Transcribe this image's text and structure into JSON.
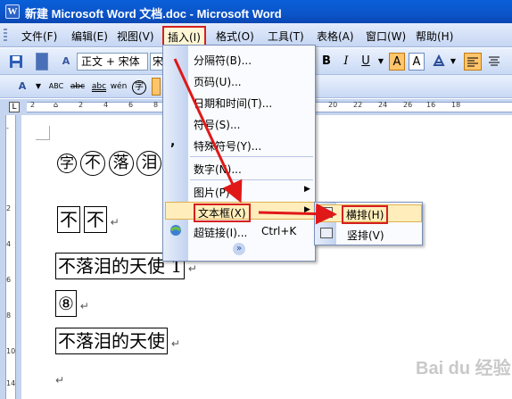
{
  "window": {
    "title": "新建 Microsoft Word 文档.doc - Microsoft Word",
    "app_icon": "W"
  },
  "menu": {
    "items": [
      "文件(F)",
      "编辑(E)",
      "视图(V)",
      "插入(I)",
      "格式(O)",
      "工具(T)",
      "表格(A)",
      "窗口(W)",
      "帮助(H)"
    ]
  },
  "toolbar": {
    "style_value": "正文 + 宋体",
    "font_value": "宋",
    "bold": "B",
    "italic": "I",
    "underline": "U",
    "char_shading": "A",
    "char_border": "A",
    "font_size_icon": "A",
    "abc1": "ABC",
    "abc2": "abc",
    "abc3": "abc",
    "pinyin": "wén",
    "enclose": "字"
  },
  "ruler": {
    "ticks": [
      "2",
      "2",
      "4",
      "6",
      "8",
      "10",
      "12",
      "14",
      "16",
      "18",
      "20",
      "22",
      "24",
      "26"
    ],
    "vticks": [
      "2",
      "4",
      "6",
      "8",
      "10",
      "12",
      "14"
    ]
  },
  "document": {
    "circ_chars": [
      "字",
      "不",
      "落",
      "泪"
    ],
    "boxed_line": [
      "不",
      "不"
    ],
    "line3": "不落泪的天使 1",
    "line4": "⑧",
    "line5": "不落泪的天使",
    "para_mark": "↵"
  },
  "insert_menu": {
    "items": [
      "分隔符(B)...",
      "页码(U)...",
      "日期和时间(T)...",
      "符号(S)...",
      "特殊符号(Y)...",
      "数字(N)...",
      "图片(P)",
      "文本框(X)",
      "超链接(I)...",
      "Ctrl+K"
    ],
    "expand": "»"
  },
  "textbox_submenu": {
    "items": [
      "横排(H)",
      "竖排(V)"
    ]
  },
  "watermark": "Bai du 经验"
}
